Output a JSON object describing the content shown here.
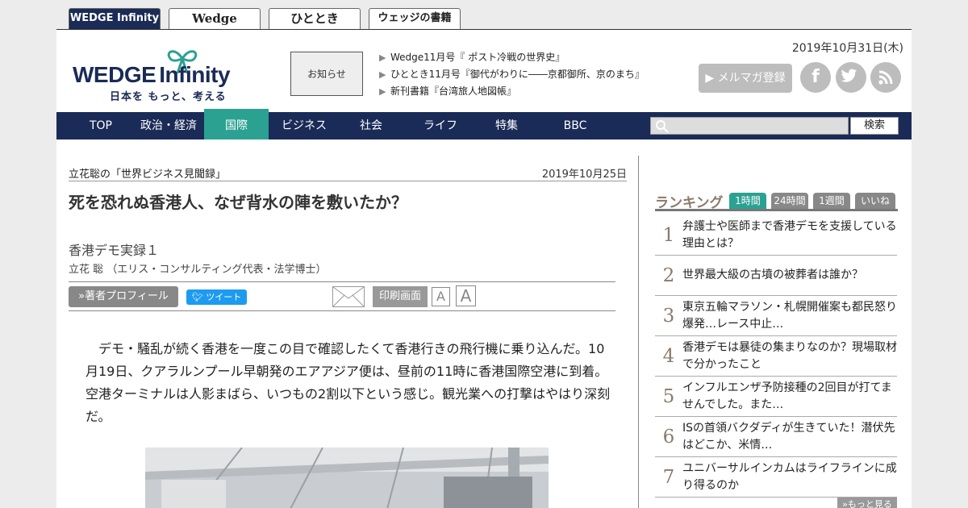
{
  "site_tabs": [
    "WEDGE Infinity",
    "Wedge",
    "ひととき",
    "ウェッジの書籍"
  ],
  "logo": {
    "main_a": "WEDGE",
    "main_b": "Infinity",
    "tagline": "日本を もっと、考える"
  },
  "notice_label": "お知らせ",
  "news": [
    "Wedge11月号『 ポスト冷戦の世界史』",
    "ひととき11月号『御代がわりに――京都御所、京のまち』",
    "新刊書籍『台湾旅人地図帳』"
  ],
  "header_date": "2019年10月31日(木)",
  "mailmag_label": "メルマガ登録",
  "social": {
    "facebook": "f",
    "twitter": "twitter-icon",
    "rss": "rss-icon"
  },
  "nav": [
    "TOP",
    "政治・経済",
    "国際",
    "ビジネス",
    "社会",
    "ライフ",
    "特集",
    "BBC"
  ],
  "search": {
    "placeholder": "",
    "button": "検索"
  },
  "article": {
    "series": "立花聡の「世界ビジネス見聞録」",
    "date": "2019年10月25日",
    "headline": "死を恐れぬ香港人、なぜ背水の陣を敷いたか？",
    "subtitle": "香港デモ実録１",
    "author": "立花 聡 （エリス・コンサルティング代表・法学博士）",
    "profile_button": "»著者プロフィール",
    "tweet_button": "ツイート",
    "print_button": "印刷画面",
    "font_small": "A",
    "font_large": "A",
    "body": "　デモ・騒乱が続く香港を一度この目で確認したくて香港行きの飛行機に乗り込んだ。10月19日、クアラルンプール早朝発のエアアジア便は、昼前の11時に香港国際空港に到着。空港ターミナルは人影まばら、いつもの2割以下という感じ。観光業への打撃はやはり深刻だ。"
  },
  "ranking": {
    "title": "ランキング",
    "tabs": [
      "1時間",
      "24時間",
      "1週間",
      "いいね"
    ],
    "items": [
      {
        "num": "1",
        "text": "弁護士や医師まで香港デモを支援している理由とは？"
      },
      {
        "num": "2",
        "text": "世界最大級の古墳の被葬者は誰か？"
      },
      {
        "num": "3",
        "text": "東京五輪マラソン・札幌開催案も都民怒り爆発…レース中止…"
      },
      {
        "num": "4",
        "text": "香港デモは暴徒の集まりなのか？現場取材で分かったこと"
      },
      {
        "num": "5",
        "text": "インフルエンザ予防接種の2回目が打てませんでした。また…"
      },
      {
        "num": "6",
        "text": "ISの首領バクダディが生きていた！潜伏先はどこか、米情…"
      },
      {
        "num": "7",
        "text": "ユニバーサルインカムはライフラインに成り得るのか"
      }
    ],
    "more": "»もっと見る"
  }
}
